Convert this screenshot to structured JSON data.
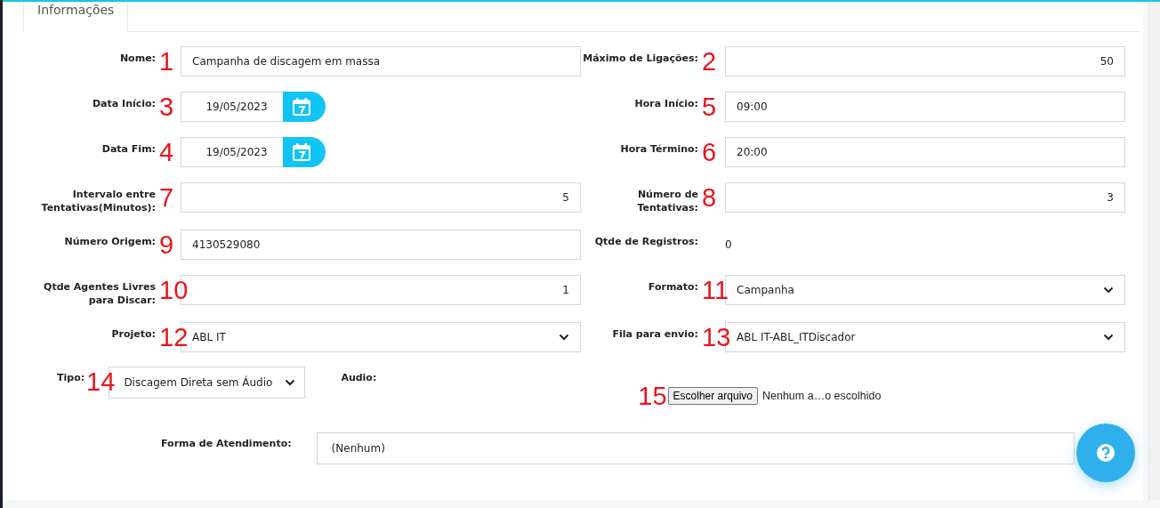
{
  "tab": {
    "label": "Informações",
    "selected": true
  },
  "fields": [
    {
      "kind": "text",
      "label": "Nome:",
      "annotation": "1",
      "value": "Campanha de discagem em massa"
    },
    {
      "kind": "number",
      "label": "Máximo de Ligações:",
      "annotation": "2",
      "value": "50"
    },
    {
      "kind": "date",
      "label": "Data Início:",
      "annotation": "3",
      "value": "19/05/2023"
    },
    {
      "kind": "text",
      "label": "Hora Início:",
      "annotation": "5",
      "value": "09:00"
    },
    {
      "kind": "date",
      "label": "Data Fim:",
      "annotation": "4",
      "value": "19/05/2023"
    },
    {
      "kind": "text",
      "label": "Hora Término:",
      "annotation": "6",
      "value": "20:00"
    },
    {
      "kind": "number",
      "label": "Intervalo entre Tentativas(Minutos):",
      "annotation": "7",
      "value": "5"
    },
    {
      "kind": "number",
      "label": "Número de Tentativas:",
      "annotation": "8",
      "value": "3"
    },
    {
      "kind": "text",
      "label": "Número Origem:",
      "annotation": "9",
      "value": "4130529080"
    },
    {
      "kind": "readout",
      "label": "Qtde de Registros:",
      "value": "0"
    },
    {
      "kind": "number",
      "label": "Qtde Agentes Livres para Discar:",
      "annotation": "10",
      "value": "1"
    },
    {
      "kind": "select",
      "label": "Formato:",
      "annotation": "11",
      "value": "Campanha"
    },
    {
      "kind": "select",
      "label": "Projeto:",
      "annotation": "12",
      "value": "ABL IT"
    },
    {
      "kind": "select",
      "label": "Fila para envio:",
      "annotation": "13",
      "value": "ABL IT-ABL_ITDiscador"
    }
  ],
  "tipo": {
    "label": "Tipo:",
    "annotation": "14",
    "value": "Discagem Direta sem Áudio"
  },
  "audio": {
    "label": "Audio:",
    "annotation": "15",
    "button": "Escolher arquivo",
    "status": "Nenhum a…o escolhido"
  },
  "forma": {
    "label": "Forma de Atendimento:",
    "value": "(Nenhum)"
  }
}
